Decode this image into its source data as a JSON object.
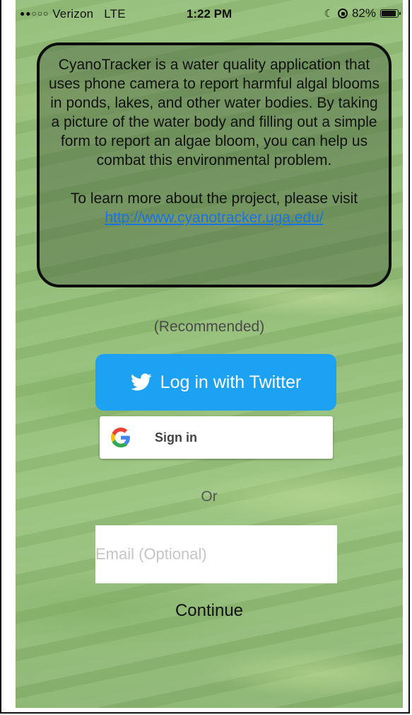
{
  "status_bar": {
    "signal_dots": "●●○○○",
    "carrier": "Verizon",
    "network": "LTE",
    "time": "1:22 PM",
    "battery_percent": "82%",
    "battery_level": 0.82,
    "icons": [
      "moon-icon",
      "rotation-lock-icon",
      "battery-icon"
    ]
  },
  "info": {
    "description": "CyanoTracker is a water quality application that uses phone camera to report harmful algal blooms in ponds, lakes, and other water bodies. By taking a picture of the water body and filling out a simple form to report an algae bloom, you can help us combat this environmental problem.",
    "learn_more": "To learn more about the project, please visit",
    "link": "http://www.cyanotracker.uga.edu/"
  },
  "login": {
    "recommended": "(Recommended)",
    "twitter_label": "Log in with Twitter",
    "google_label": "Sign in",
    "or": "Or",
    "email_placeholder": "Email (Optional)",
    "email_value": "",
    "continue_label": "Continue"
  },
  "colors": {
    "twitter": "#1da1f2",
    "link": "#1a73e8",
    "background": "#93be78"
  }
}
